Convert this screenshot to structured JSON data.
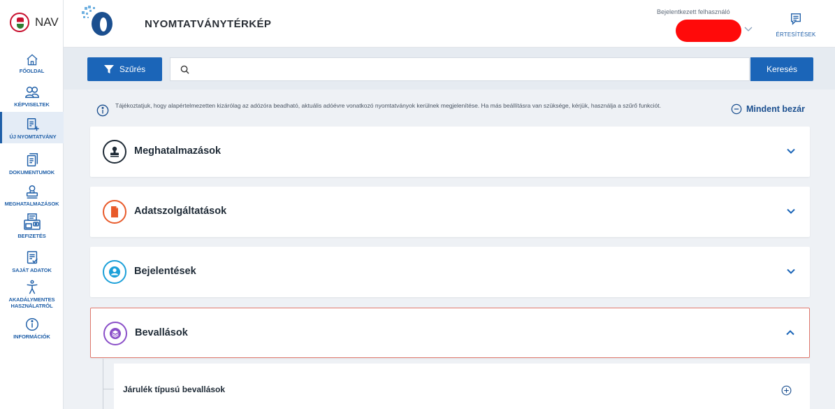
{
  "brand": {
    "name": "NAV"
  },
  "sidebar": {
    "items": [
      {
        "label": "FŐOLDAL",
        "icon": "home-icon"
      },
      {
        "label": "KÉPVISELTEK",
        "icon": "people-icon"
      },
      {
        "label": "ÚJ NYOMTATVÁNY",
        "icon": "new-form-icon",
        "active": true
      },
      {
        "label": "DOKUMENTUMOK",
        "icon": "documents-icon"
      },
      {
        "label": "MEGHATALMAZÁSOK",
        "icon": "authorization-icon"
      },
      {
        "label": "BEFIZETÉS",
        "icon": "payment-icon"
      },
      {
        "label": "SAJÁT ADATOK",
        "icon": "own-data-icon"
      },
      {
        "label": "AKADÁLYMENTES HASZNÁLATRÓL",
        "icon": "accessibility-icon"
      },
      {
        "label": "INFORMÁCIÓK",
        "icon": "info-icon"
      }
    ]
  },
  "header": {
    "title": "NYOMTATVÁNYTÉRKÉP",
    "user_label": "Bejelentkezett felhasználó",
    "notifications_label": "ÉRTESÍTÉSEK"
  },
  "search": {
    "filter_label": "Szűrés",
    "placeholder": "",
    "value": "",
    "button_label": "Keresés"
  },
  "info": {
    "text": "Tájékoztatjuk, hogy alapértelmezetten kizárólag az adózóra beadható, aktuális adóévre vonatkozó nyomtatványok kerülnek megjelenítése. Ha más beállításra van szüksége, kérjük, használja a szűrő funkciót.",
    "collapse_all_label": "Mindent bezár"
  },
  "categories": [
    {
      "title": "Meghatalmazások",
      "icon": "stamp-icon",
      "expanded": false,
      "color": "#1e2a36"
    },
    {
      "title": "Adatszolgáltatások",
      "icon": "document-icon",
      "expanded": false,
      "color": "#e85a2a"
    },
    {
      "title": "Bejelentések",
      "icon": "person-icon",
      "expanded": false,
      "color": "#1ca0d9"
    },
    {
      "title": "Bevallások",
      "icon": "layers-icon",
      "expanded": true,
      "color": "#8a4fc8"
    }
  ],
  "subcategories": [
    {
      "title": "Járulék típusú bevallások"
    }
  ],
  "colors": {
    "accent": "#1b65b8",
    "nav_blue": "#1f5fa8",
    "redaction": "#ff0a0a",
    "expanded_border": "#e0786c"
  }
}
